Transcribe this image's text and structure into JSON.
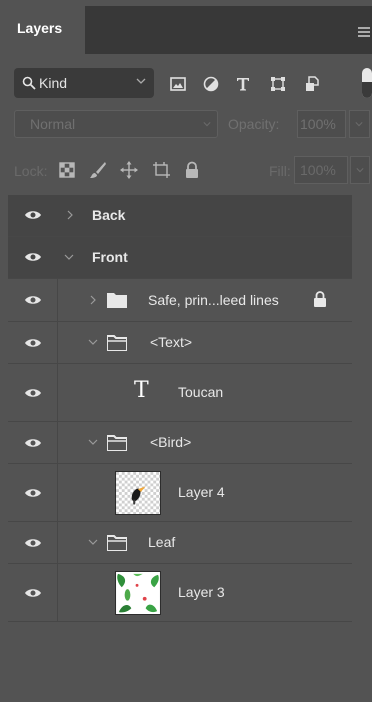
{
  "panel": {
    "tab_label": "Layers",
    "menu_icon": "hamburger-menu-icon"
  },
  "filter": {
    "kind_label": "Kind",
    "icons": [
      "image-filter-icon",
      "adjustment-filter-icon",
      "type-filter-icon",
      "shape-filter-icon",
      "smart-object-filter-icon"
    ],
    "filter_toggle": "on"
  },
  "blend": {
    "mode": "Normal",
    "opacity_label": "Opacity:",
    "opacity_value": "100%"
  },
  "lock": {
    "label": "Lock:",
    "icons": [
      "lock-transparent-pixels-icon",
      "lock-image-pixels-icon",
      "lock-position-icon",
      "lock-artboard-icon",
      "lock-all-icon"
    ],
    "fill_label": "Fill:",
    "fill_value": "100%"
  },
  "layers": [
    {
      "name": "Back",
      "kind": "artboard",
      "expanded": false,
      "visible": true
    },
    {
      "name": "Front",
      "kind": "artboard",
      "expanded": true,
      "visible": true
    },
    {
      "name": "Safe, prin...leed lines",
      "kind": "group",
      "expanded": false,
      "visible": true,
      "locked": true
    },
    {
      "name": "<Text>",
      "kind": "group",
      "expanded": true,
      "visible": true
    },
    {
      "name": "Toucan",
      "kind": "type",
      "visible": true
    },
    {
      "name": "<Bird>",
      "kind": "group",
      "expanded": true,
      "visible": true
    },
    {
      "name": "Layer 4",
      "kind": "pixel",
      "visible": true
    },
    {
      "name": "Leaf",
      "kind": "group",
      "expanded": true,
      "visible": true
    },
    {
      "name": "Layer 3",
      "kind": "pixel",
      "visible": true
    }
  ],
  "colors": {
    "panel_bg": "#535353",
    "tab_bar_bg": "#383838",
    "artboard_row_bg": "#454545",
    "text": "#e8e8e8",
    "disabled_text": "#707070"
  }
}
